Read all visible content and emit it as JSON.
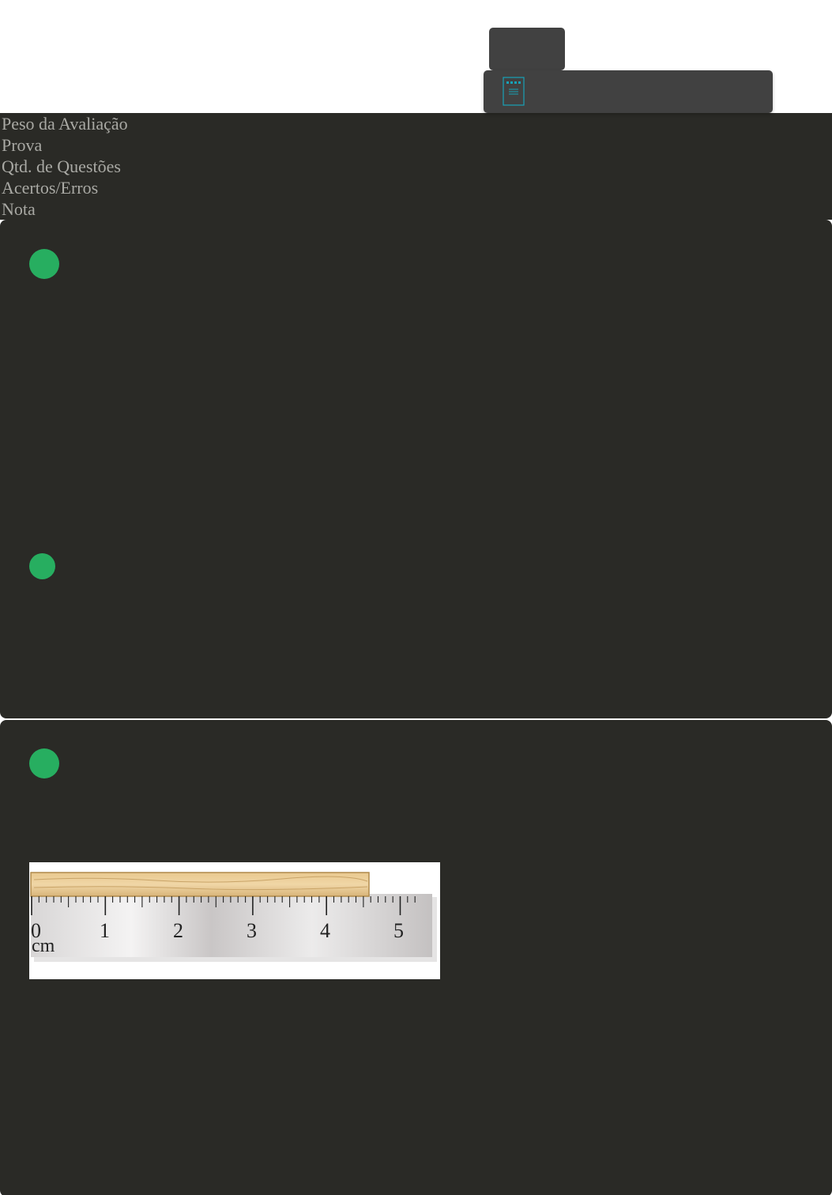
{
  "summary": {
    "rows": [
      "Peso da Avaliação",
      "Prova",
      "Qtd. de Questões",
      "Acertos/Erros",
      "Nota"
    ]
  },
  "figure": {
    "tick_labels": [
      "0",
      "1",
      "2",
      "3",
      "4",
      "5"
    ],
    "unit": "cm"
  },
  "colors": {
    "page_background": "#ffffff",
    "panel_background": "#2a2a26",
    "toolbar_background": "#414141",
    "status_correct": "#27ae60",
    "icon_accent": "#17a2b8",
    "label_text": "#a9a9a4"
  },
  "icons": {
    "toolbar_icon": "document-icon",
    "status": "status-dot"
  }
}
